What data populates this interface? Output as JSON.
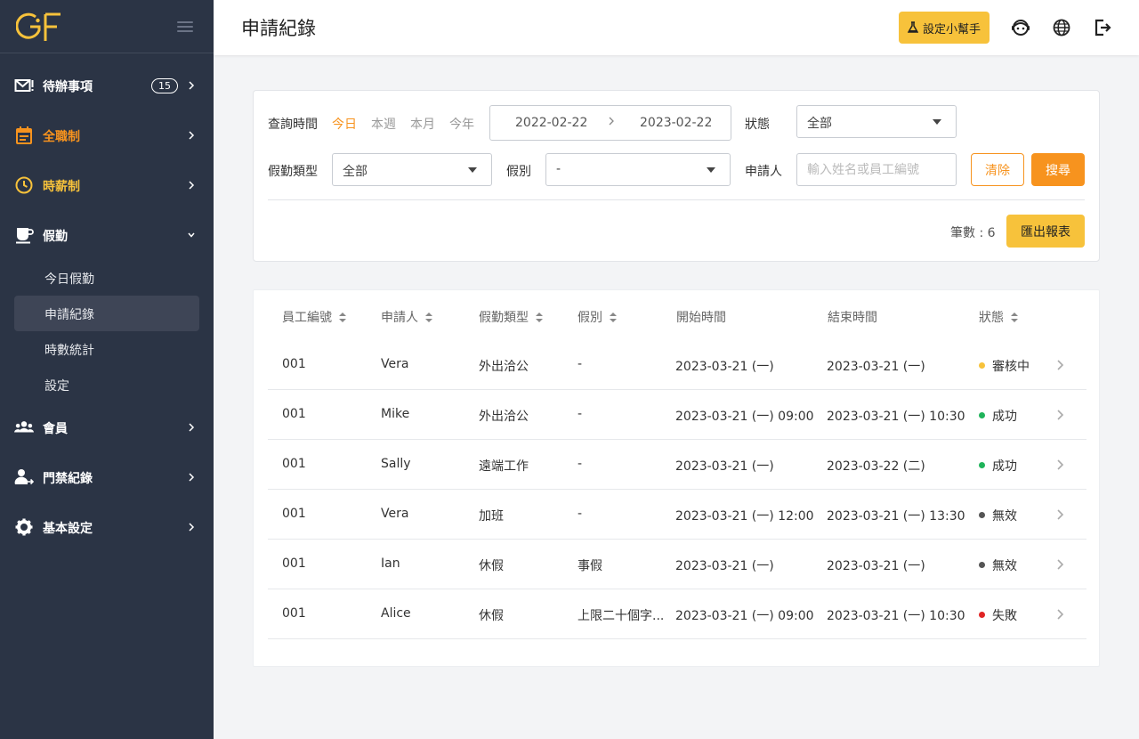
{
  "logo": {
    "text": "GF"
  },
  "sidebar": {
    "items": [
      {
        "label": "待辦事項",
        "badge": "15"
      },
      {
        "label": "全職制"
      },
      {
        "label": "時薪制"
      },
      {
        "label": "假勤"
      },
      {
        "label": "會員"
      },
      {
        "label": "門禁紀錄"
      },
      {
        "label": "基本設定"
      }
    ],
    "sub_items": [
      {
        "label": "今日假勤"
      },
      {
        "label": "申請紀錄"
      },
      {
        "label": "時數統計"
      },
      {
        "label": "設定"
      }
    ]
  },
  "header": {
    "title": "申請紀錄",
    "helper_button": "設定小幫手"
  },
  "filters": {
    "query_time_label": "查詢時間",
    "quick_ranges": [
      "今日",
      "本週",
      "本月",
      "今年"
    ],
    "date_start": "2022-02-22",
    "date_end": "2023-02-22",
    "status_label": "狀態",
    "status_value": "全部",
    "type_label": "假勤類型",
    "type_value": "全部",
    "leave_label": "假別",
    "leave_value": "-",
    "applicant_label": "申請人",
    "applicant_placeholder": "輸入姓名或員工編號",
    "clear_button": "清除",
    "search_button": "搜尋",
    "count_text": "筆數 : 6",
    "export_button": "匯出報表"
  },
  "table": {
    "columns": [
      "員工編號",
      "申請人",
      "假勤類型",
      "假別",
      "開始時間",
      "結束時間",
      "狀態"
    ],
    "rows": [
      {
        "id": "001",
        "applicant": "Vera",
        "type": "外出洽公",
        "leave": "-",
        "start": "2023-03-21 (一)",
        "end": "2023-03-21 (一)",
        "status": "審核中",
        "status_color": "#f7c23b"
      },
      {
        "id": "001",
        "applicant": "Mike",
        "type": "外出洽公",
        "leave": "-",
        "start": "2023-03-21 (一) 09:00",
        "end": "2023-03-21 (一) 10:30",
        "status": "成功",
        "status_color": "#1fb35a"
      },
      {
        "id": "001",
        "applicant": "Sally",
        "type": "遠端工作",
        "leave": "-",
        "start": "2023-03-21 (一)",
        "end": "2023-03-22 (二)",
        "status": "成功",
        "status_color": "#1fb35a"
      },
      {
        "id": "001",
        "applicant": "Vera",
        "type": "加班",
        "leave": "-",
        "start": "2023-03-21 (一) 12:00",
        "end": "2023-03-21 (一) 13:30",
        "status": "無效",
        "status_color": "#555555"
      },
      {
        "id": "001",
        "applicant": "Ian",
        "type": "休假",
        "leave": "事假",
        "start": "2023-03-21 (一)",
        "end": "2023-03-21 (一)",
        "status": "無效",
        "status_color": "#555555"
      },
      {
        "id": "001",
        "applicant": "Alice",
        "type": "休假",
        "leave": "上限二十個字...",
        "start": "2023-03-21 (一) 09:00",
        "end": "2023-03-21 (一) 10:30",
        "status": "失敗",
        "status_color": "#e02424"
      }
    ]
  },
  "colors": {
    "sidebar_bg": "#2b3445",
    "accent_orange": "#f7931e",
    "accent_yellow": "#f7c23b"
  }
}
